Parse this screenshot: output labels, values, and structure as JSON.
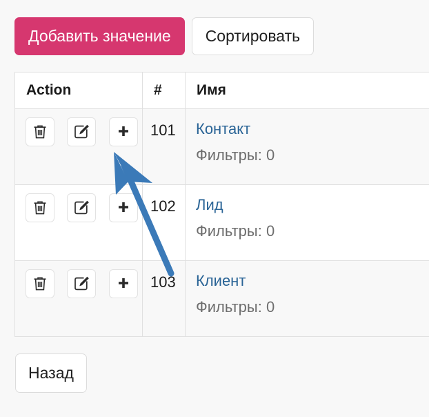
{
  "toolbar": {
    "add_value_label": "Добавить значение",
    "sort_label": "Сортировать",
    "add_value_color": "#d6376f"
  },
  "table": {
    "headers": {
      "action": "Action",
      "id": "#",
      "name": "Имя"
    },
    "rows": [
      {
        "id": "101",
        "name": "Контакт",
        "filters": "Фильтры: 0"
      },
      {
        "id": "102",
        "name": "Лид",
        "filters": "Фильтры: 0"
      },
      {
        "id": "103",
        "name": "Клиент",
        "filters": "Фильтры: 0"
      }
    ],
    "actions": {
      "delete": "trash-icon",
      "edit": "edit-pencil-icon",
      "add": "plus-icon"
    },
    "link_color": "#2a6496",
    "filters_color": "#6e6e6e"
  },
  "footer": {
    "back_label": "Назад"
  },
  "annotation": {
    "pointer": "mouse-cursor-arrow",
    "color": "#3b7ab8"
  }
}
